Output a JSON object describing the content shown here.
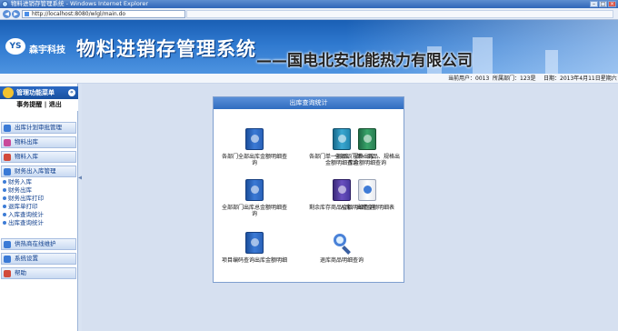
{
  "window": {
    "title": "物料进销存管理系统 - Windows Internet Explorer"
  },
  "browser": {
    "url": "http://localhost:8080/wlgl/main.do"
  },
  "banner": {
    "logo_name": "森宇科技",
    "system_title": "物料进销存管理系统",
    "company": "——国电北安北能热力有限公司"
  },
  "infobar": {
    "current_user": "当前用户：0013",
    "department": "所属部门：123是",
    "date": "日期：2013年4月11日星期六"
  },
  "sidebar": {
    "header": "管理功能菜单",
    "user_actions": "事务提醒 | 退出",
    "sections": [
      {
        "label": "出库计划审批管理"
      },
      {
        "label": "物料出库"
      },
      {
        "label": "物料入库"
      },
      {
        "label": "财务出入库管理"
      },
      {
        "label": "供热商在线维护"
      },
      {
        "label": "系统设置"
      },
      {
        "label": "帮助"
      }
    ],
    "subitems": [
      "财务入库",
      "财务出库",
      "财务出库打印",
      "退库单打印",
      "入库查询统计",
      "出库查询统计"
    ]
  },
  "panel": {
    "title": "出库查询统计",
    "items": [
      {
        "label": "各部门全部出库金额明细查询",
        "icon": "book-icon"
      },
      {
        "label": "各部门单一商品、规格出库金额明细查询",
        "icon": "book-icon"
      },
      {
        "label": "全部部门单一商品、规格出库金额明细查询",
        "icon": "book-icon"
      },
      {
        "label": "全部部门出库总金额明细查询",
        "icon": "book-icon"
      },
      {
        "label": "剩余库存商品金额明细查询",
        "icon": "book-icon"
      },
      {
        "label": "入库、出库金额明细表",
        "icon": "book-icon"
      },
      {
        "label": "项目编码查询出库金额明细",
        "icon": "book-icon"
      },
      {
        "label": "退库商品明细查询",
        "icon": "magnifier-icon"
      }
    ]
  },
  "colors": {
    "accent": "#2f6cc0",
    "banner": "#1a5fb4",
    "content_bg": "#d6e0f0"
  }
}
